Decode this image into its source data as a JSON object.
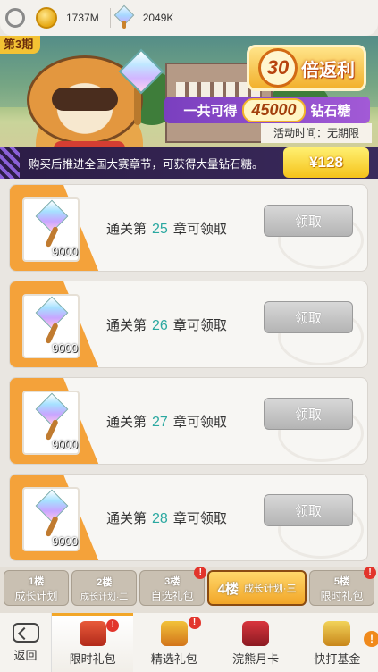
{
  "topbar": {
    "coins": "1737M",
    "gems": "2049K"
  },
  "banner": {
    "period_tag": "第3期",
    "rebate_multiplier": "30",
    "rebate_text": "倍返利",
    "total_prefix": "一共可得",
    "total_amount": "45000",
    "total_suffix": "钻石糖",
    "activity_time": "活动时间：无期限",
    "description": "购买后推进全国大赛章节，可获得大量钻石糖。",
    "price": "¥128"
  },
  "rewards": [
    {
      "qty": "9000",
      "prefix": "通关第",
      "chapter": "25",
      "suffix": "章可领取",
      "button": "领取"
    },
    {
      "qty": "9000",
      "prefix": "通关第",
      "chapter": "26",
      "suffix": "章可领取",
      "button": "领取"
    },
    {
      "qty": "9000",
      "prefix": "通关第",
      "chapter": "27",
      "suffix": "章可领取",
      "button": "领取"
    },
    {
      "qty": "9000",
      "prefix": "通关第",
      "chapter": "28",
      "suffix": "章可领取",
      "button": "领取"
    }
  ],
  "tiers": [
    {
      "floor": "1楼",
      "name": "成长计划"
    },
    {
      "floor": "2楼",
      "name": "成长计划·二"
    },
    {
      "floor": "3楼",
      "name": "自选礼包",
      "badge": "!"
    },
    {
      "floor": "4楼",
      "name": "成长计划·三"
    },
    {
      "floor": "5楼",
      "name": "限时礼包",
      "badge": "!"
    }
  ],
  "bottom_nav": {
    "back": "返回",
    "items": [
      {
        "label": "限时礼包",
        "badge": "!"
      },
      {
        "label": "精选礼包",
        "badge": "!"
      },
      {
        "label": "浣熊月卡"
      },
      {
        "label": "快打基金",
        "badge": "!"
      }
    ]
  },
  "colors": {
    "accent_orange": "#f2a628",
    "chapter_teal": "#2aa8a0",
    "banner_purple": "#7a3fbf",
    "badge_red": "#e2352c"
  }
}
